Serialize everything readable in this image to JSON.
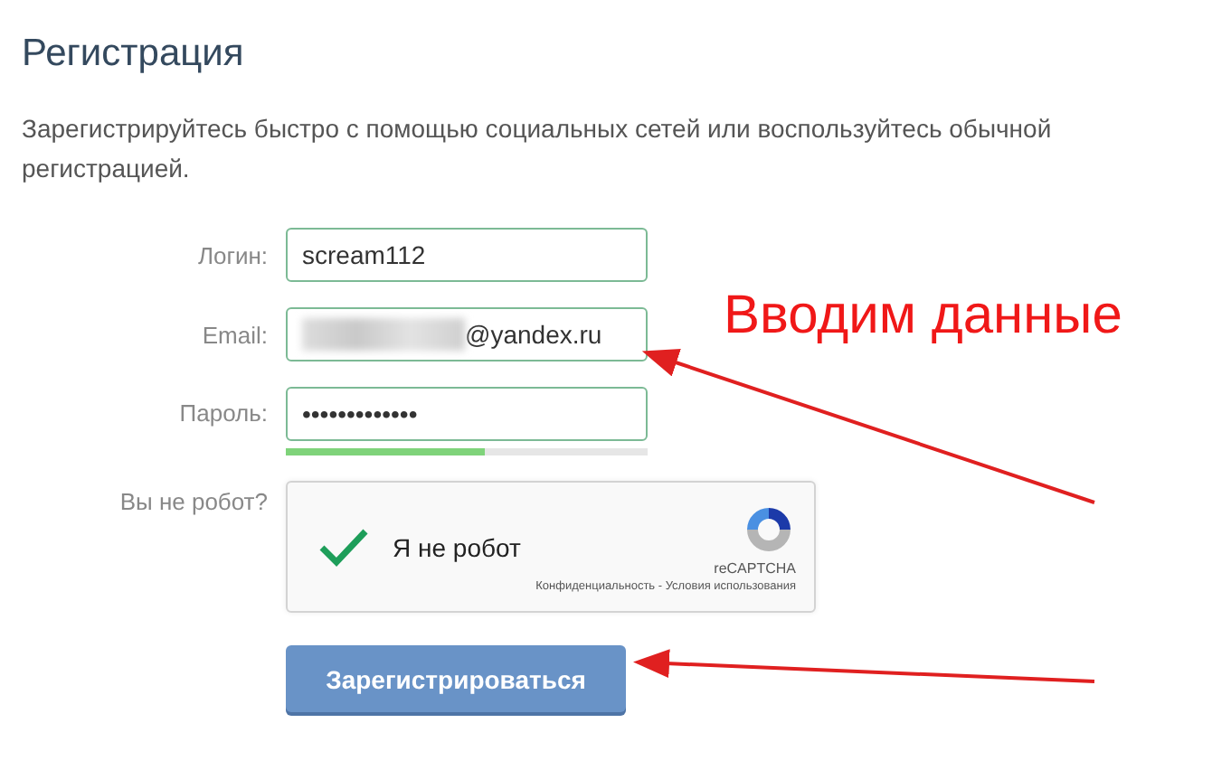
{
  "title": "Регистрация",
  "intro": "Зарегистрируйтесь быстро с помощью социальных сетей или воспользуйтесь обычной регистрацией.",
  "fields": [
    {
      "label": "Логин:",
      "value": "scream112",
      "kind": "text"
    },
    {
      "label": "Email:",
      "value": "@yandex.ru",
      "kind": "blurred"
    },
    {
      "label": "Пароль:",
      "value": "•••••••••••••",
      "kind": "password",
      "level": 0.55
    }
  ],
  "captcha": {
    "label": "Вы не робот?",
    "text": "Я не робот",
    "checked": true,
    "brand": "reCAPTCHA",
    "privacy": "Конфиденциальность",
    "separator": " - ",
    "terms": "Условия использования"
  },
  "submit": "Зарегистрироваться",
  "annotation": {
    "text": "Вводим данные"
  }
}
